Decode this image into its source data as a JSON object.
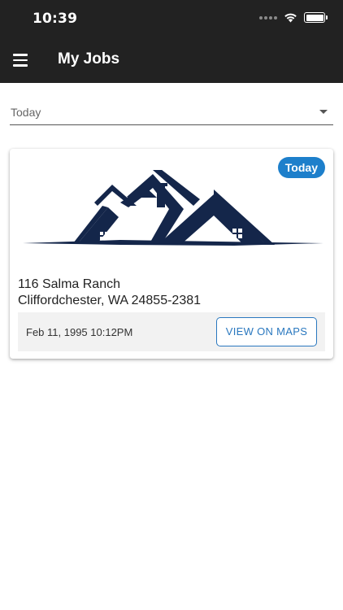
{
  "status_bar": {
    "time": "10:39"
  },
  "header": {
    "title": "My Jobs",
    "menu_icon": "hamburger-menu-icon"
  },
  "filter": {
    "selected": "Today",
    "icon": "dropdown-caret-icon"
  },
  "jobs": [
    {
      "badge": "Today",
      "address_line1": "116 Salma Ranch",
      "address_line2": "Cliffordchester, WA 24855-2381",
      "datetime": "Feb 11, 1995 10:12PM",
      "maps_button": "VIEW ON MAPS"
    }
  ],
  "colors": {
    "header_bg": "#222222",
    "badge_bg": "#1d7fcb",
    "accent": "#2a78bf",
    "logo": "#14264a"
  }
}
